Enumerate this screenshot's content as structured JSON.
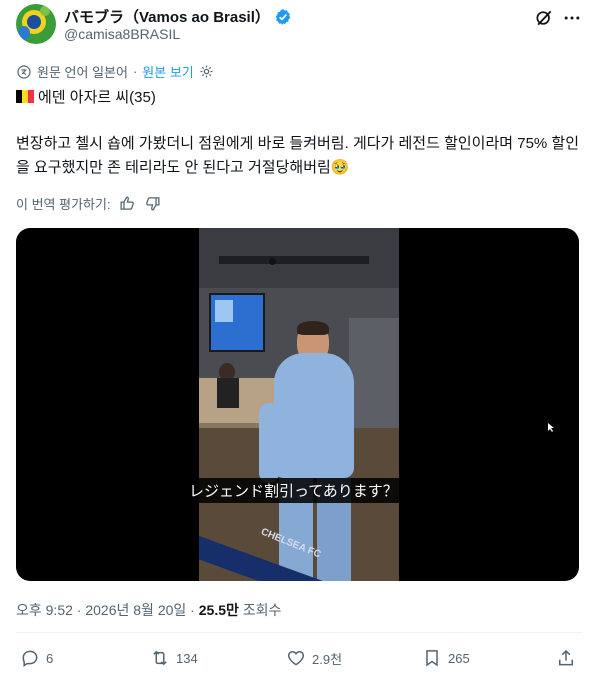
{
  "author": {
    "name": "バモブラ（Vamos ao Brasil）",
    "handle": "@camisa8BRASIL"
  },
  "translation": {
    "label": "원문 언어 일본어",
    "link": "원본 보기"
  },
  "post": {
    "line1": "에덴 아자르 씨(35)",
    "body": "변장하고 첼시 숍에 가봤더니 점원에게 바로 들켜버림. 게다가 레전드 할인이라며 75% 할인을 요구했지만 존 테리라도 안 된다고 거절당해버림🥹",
    "rate_translation": "이 번역 평가하기:"
  },
  "video": {
    "subtitle": "レジェンド割引ってあります？",
    "banner_text": "CHELSEA FC"
  },
  "meta": {
    "time": "오후 9:52",
    "date": "2026년 8월 20일",
    "views": "25.5만",
    "views_label": "조회수"
  },
  "actions": {
    "replies": "6",
    "reposts": "134",
    "likes": "2.9천",
    "bookmarks": "265"
  },
  "colors": {
    "accent": "#1d9bf0",
    "verified": "#1d9bf0",
    "muted": "#536471"
  }
}
